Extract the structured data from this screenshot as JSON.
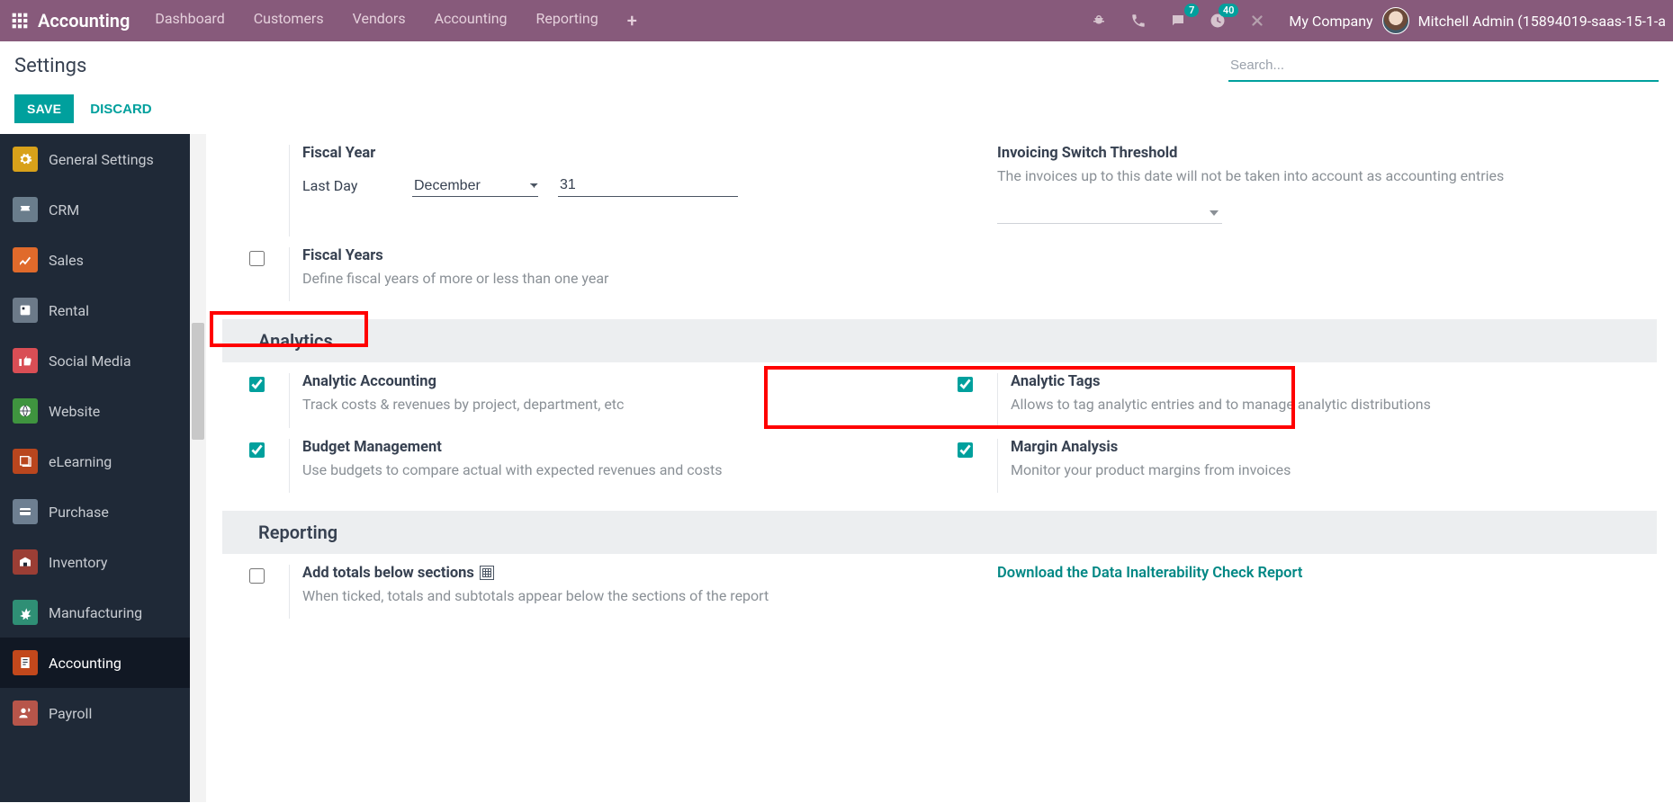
{
  "topbar": {
    "brand": "Accounting",
    "nav": [
      "Dashboard",
      "Customers",
      "Vendors",
      "Accounting",
      "Reporting"
    ],
    "messages_badge": "7",
    "activities_badge": "40",
    "company": "My Company",
    "user": "Mitchell Admin (15894019-saas-15-1-a"
  },
  "control": {
    "title": "Settings",
    "save": "SAVE",
    "discard": "DISCARD",
    "search_placeholder": "Search..."
  },
  "sidebar": {
    "items": [
      {
        "label": "General Settings"
      },
      {
        "label": "CRM"
      },
      {
        "label": "Sales"
      },
      {
        "label": "Rental"
      },
      {
        "label": "Social Media"
      },
      {
        "label": "Website"
      },
      {
        "label": "eLearning"
      },
      {
        "label": "Purchase"
      },
      {
        "label": "Inventory"
      },
      {
        "label": "Manufacturing"
      },
      {
        "label": "Accounting"
      },
      {
        "label": "Payroll"
      }
    ]
  },
  "fiscal": {
    "header": "Fiscal Year",
    "last_day_label": "Last Day",
    "month": "December",
    "day": "31",
    "fy_title": "Fiscal Years",
    "fy_desc": "Define fiscal years of more or less than one year"
  },
  "invthresh": {
    "title": "Invoicing Switch Threshold",
    "desc": "The invoices up to this date will not be taken into account as accounting entries"
  },
  "analytics": {
    "section": "Analytics",
    "aa_title": "Analytic Accounting",
    "aa_desc": "Track costs & revenues by project, department, etc",
    "at_title": "Analytic Tags",
    "at_desc": "Allows to tag analytic entries and to manage analytic distributions",
    "bm_title": "Budget Management",
    "bm_desc": "Use budgets to compare actual with expected revenues and costs",
    "ma_title": "Margin Analysis",
    "ma_desc": "Monitor your product margins from invoices"
  },
  "reporting": {
    "section": "Reporting",
    "tot_title": "Add totals below sections",
    "tot_desc": "When ticked, totals and subtotals appear below the sections of the report",
    "dl_link": "Download the Data Inalterability Check Report"
  }
}
